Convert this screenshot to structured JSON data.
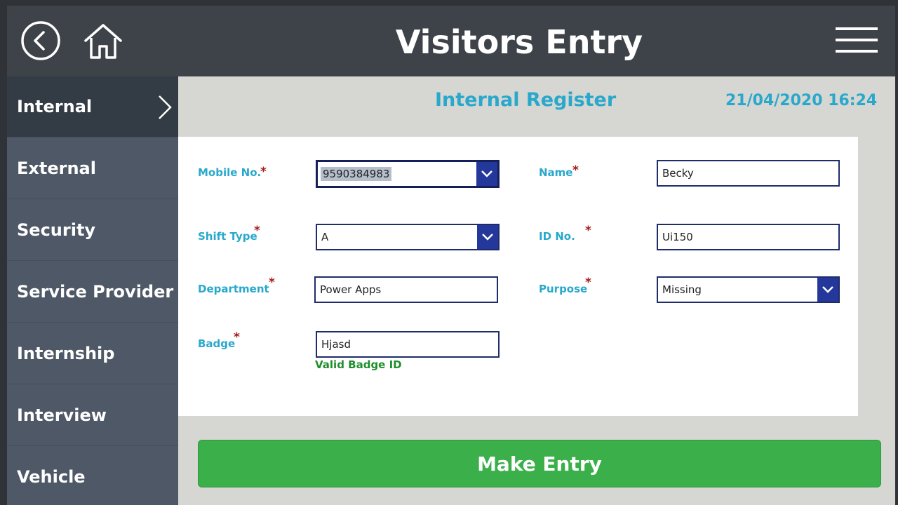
{
  "header": {
    "title": "Visitors Entry",
    "back_icon": "back-circle-icon",
    "home_icon": "home-icon",
    "menu_icon": "hamburger-menu-icon"
  },
  "sidebar": {
    "items": [
      {
        "label": "Internal",
        "active": true
      },
      {
        "label": "External",
        "active": false
      },
      {
        "label": "Security",
        "active": false
      },
      {
        "label": "Service Provider",
        "active": false
      },
      {
        "label": "Internship",
        "active": false
      },
      {
        "label": "Interview",
        "active": false
      },
      {
        "label": "Vehicle",
        "active": false
      }
    ]
  },
  "main": {
    "section_title": "Internal Register",
    "datetime": "21/04/2020 16:24",
    "form": {
      "mobile": {
        "label": "Mobile No.",
        "required": "*",
        "value": "9590384983"
      },
      "name": {
        "label": "Name",
        "required": "*",
        "value": "Becky"
      },
      "shift_type": {
        "label": "Shift Type",
        "required": "*",
        "value": "A"
      },
      "id_no": {
        "label": "ID No.",
        "required": "*",
        "value": "Ui150"
      },
      "department": {
        "label": "Department",
        "required": "*",
        "value": "Power Apps"
      },
      "purpose": {
        "label": "Purpose",
        "required": "*",
        "value": "Missing"
      },
      "badge": {
        "label": "Badge",
        "required": "*",
        "value": "Hjasd",
        "validation": "Valid Badge ID"
      }
    },
    "submit_label": "Make Entry"
  },
  "colors": {
    "header_bg": "#3e4349",
    "sidebar_bg": "#4e5866",
    "sidebar_active_bg": "#333b45",
    "accent_text": "#29a8cc",
    "dropdown_button": "#24379b",
    "required_mark": "#a31b1b",
    "valid_text": "#1e8f2a",
    "submit_bg": "#3aaf4a"
  }
}
